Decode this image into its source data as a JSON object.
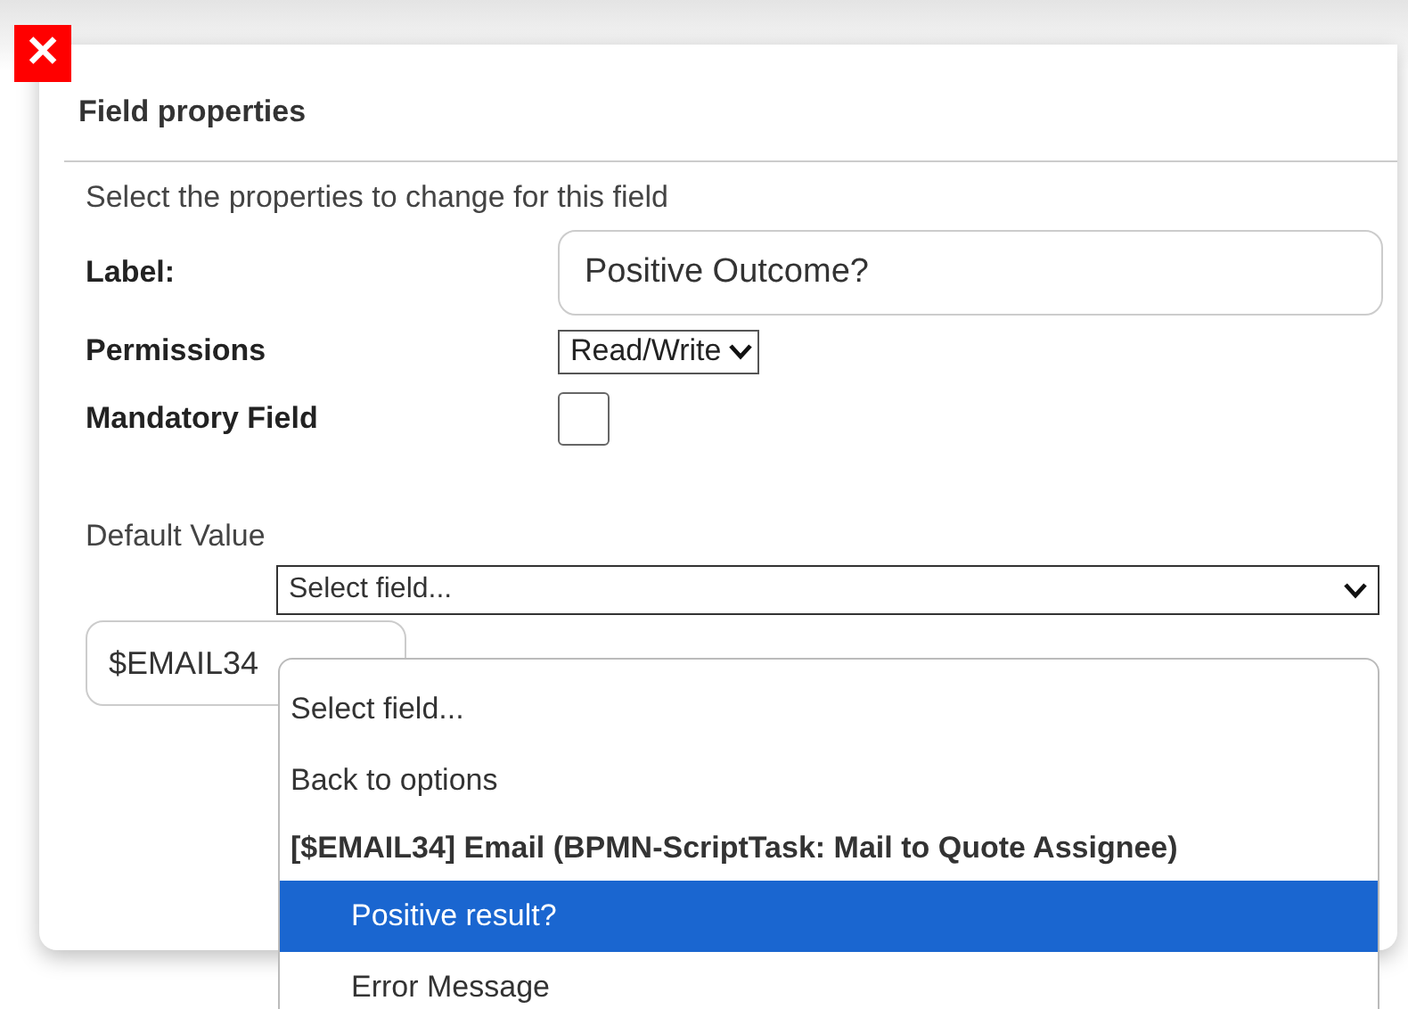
{
  "close_button": {
    "label": "✕"
  },
  "dialog": {
    "title": "Field properties",
    "intro": "Select the properties to change for this field",
    "label_field": {
      "label": "Label:",
      "value": "Positive Outcome?"
    },
    "permissions": {
      "label": "Permissions",
      "value": "Read/Write"
    },
    "mandatory": {
      "label": "Mandatory Field",
      "checked": false
    },
    "default_value": {
      "label": "Default Value",
      "select_value": "Select field...",
      "text_value": "$EMAIL34",
      "dropdown": {
        "expanded": true,
        "options": [
          {
            "kind": "option",
            "label": "Select field...",
            "selected": false
          },
          {
            "kind": "option",
            "label": "Back to options",
            "selected": false
          },
          {
            "kind": "group",
            "label": "[$EMAIL34] Email (BPMN-ScriptTask: Mail to Quote Assignee)",
            "selected": false
          },
          {
            "kind": "suboption",
            "label": "Positive result?",
            "selected": true
          },
          {
            "kind": "suboption",
            "label": "Error Message",
            "selected": false
          }
        ]
      }
    }
  }
}
